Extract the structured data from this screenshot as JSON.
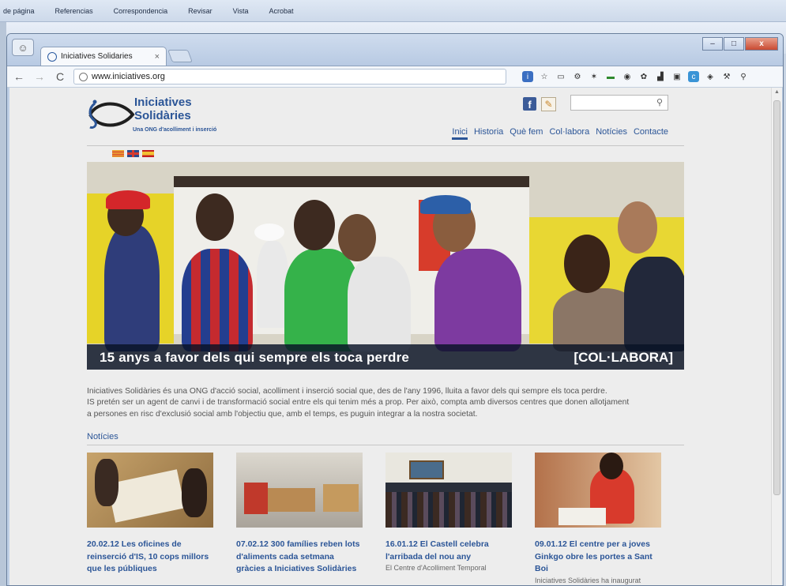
{
  "word_menu": [
    "de página",
    "Referencias",
    "Correspondencia",
    "Revisar",
    "Vista",
    "Acrobat"
  ],
  "browser": {
    "tab_title": "Iniciatives Solidaries",
    "tab_close": "×",
    "url": "www.iniciatives.org",
    "back": "←",
    "forward": "→",
    "reload": "C",
    "win_min": "–",
    "win_max": "□",
    "win_close": "x"
  },
  "site": {
    "logo_line1": "Iniciatives",
    "logo_line2": "Solidàries",
    "logo_tagline": "Una ONG d'acolliment i inserció",
    "nav": [
      "Inici",
      "Historia",
      "Què fem",
      "Col·labora",
      "Notícies",
      "Contacte"
    ],
    "active_nav": "Inici",
    "languages": [
      "ca",
      "en",
      "es"
    ],
    "hero_caption": "15 anys a favor dels qui sempre els toca perdre",
    "hero_cta": "[COL·LABORA]",
    "intro": [
      "Iniciatives Solidàries és una ONG d'acció social, acolliment i inserció social que, des de l'any 1996, lluita a favor dels qui sempre els toca perdre.",
      "IS pretén ser un agent de canvi i de transformació social entre els qui tenim més a prop. Per això, compta amb diversos centres que donen allotjament",
      "a persones en risc d'exclusió social amb l'objectiu que, amb el temps, es puguin integrar a la nostra societat."
    ],
    "news_heading": "Notícies",
    "news": [
      {
        "title": "20.02.12 Les oficines de reinserció d'IS, 10 cops millors que les públiques",
        "snippet": ""
      },
      {
        "title": "07.02.12 300 famílies reben lots d'aliments cada setmana gràcies a Iniciatives Solidàries",
        "snippet": ""
      },
      {
        "title": "16.01.12 El Castell celebra l'arribada del nou any",
        "snippet": "El Centre d'Acolliment Temporal"
      },
      {
        "title": "09.01.12 El centre per a joves Ginkgo obre les portes a Sant Boi",
        "snippet": "Iniciatives Solidàries ha inaugurat"
      }
    ]
  },
  "colors": {
    "brand": "#2b5597",
    "caption_bg": "#0a1428",
    "text": "#555555"
  },
  "icons": [
    "search-icon",
    "facebook-icon",
    "mail-icon",
    "star-icon",
    "wrench-icon"
  ]
}
